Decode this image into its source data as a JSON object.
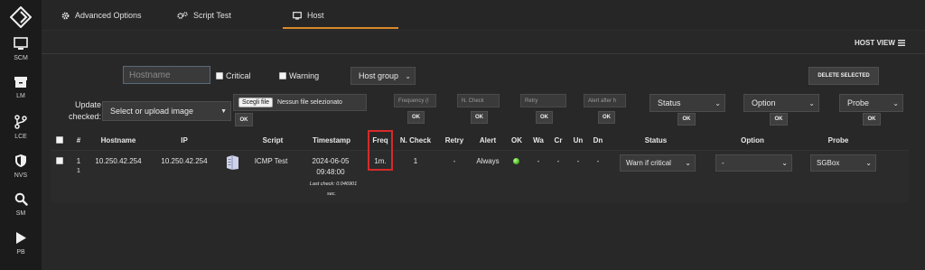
{
  "sidebar": {
    "items": [
      {
        "label": "SCM",
        "icon": "monitor-icon"
      },
      {
        "label": "LM",
        "icon": "archive-icon"
      },
      {
        "label": "LCE",
        "icon": "branch-icon"
      },
      {
        "label": "NVS",
        "icon": "shield-icon"
      },
      {
        "label": "SM",
        "icon": "search-icon"
      },
      {
        "label": "PB",
        "icon": "play-icon"
      }
    ]
  },
  "tabs": [
    {
      "label": "Advanced Options",
      "icon": "gear-icon"
    },
    {
      "label": "Script Test",
      "icon": "gears-icon"
    },
    {
      "label": "Host",
      "icon": "monitor-icon",
      "active": true
    }
  ],
  "header": {
    "host_view": "HOST VIEW"
  },
  "filters": {
    "hostname_placeholder": "Hostname",
    "critical": "Critical",
    "warning": "Warning",
    "host_group": "Host group",
    "delete_selected": "DELETE SELECTED"
  },
  "update": {
    "label_line1": "Update",
    "label_line2": "checked:",
    "upload_select": "Select or upload image",
    "file_button": "Scegli file",
    "file_status": "Nessun file selezionato",
    "frequency_placeholder": "Frequency (I",
    "ncheck_placeholder": "N. Check",
    "retry_placeholder": "Retry",
    "alert_after_placeholder": "Alert after h",
    "status_select": "Status",
    "option_select": "Option",
    "probe_select": "Probe",
    "ok": "OK"
  },
  "table": {
    "headers": [
      "#",
      "Hostname",
      "IP",
      "Script",
      "Timestamp",
      "Freq",
      "N. Check",
      "Retry",
      "Alert",
      "OK",
      "Wa",
      "Cr",
      "Un",
      "Dn",
      "Status",
      "Option",
      "Probe"
    ],
    "rows": [
      {
        "num": "1",
        "num_sub": "1",
        "hostname": "10.250.42.254",
        "ip": "10.250.42.254",
        "script": "ICMP Test",
        "timestamp_date": "2024-06-05",
        "timestamp_time": "09:48:00",
        "last_check": "Last check: 0.046901",
        "last_check_unit": "sec.",
        "freq": "1m.",
        "ncheck": "1",
        "retry": "-",
        "alert": "Always",
        "ok_status": "green",
        "wa": "-",
        "cr": "-",
        "un": "-",
        "dn": "-",
        "status": "Warn if critical",
        "option": "-",
        "probe": "SGBox"
      }
    ]
  },
  "colors": {
    "accent": "#d98a2b",
    "highlight": "#d62a2a",
    "ok": "#3fae1e"
  }
}
